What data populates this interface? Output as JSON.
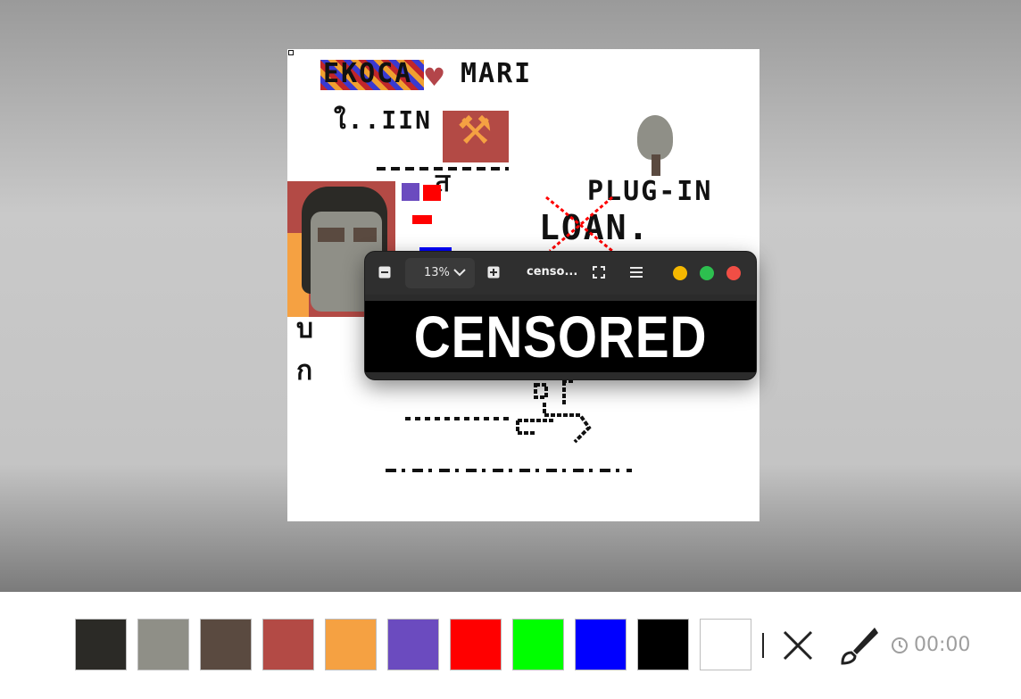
{
  "drawing": {
    "title_left": "EKOCA",
    "title_right": "MARI",
    "line2": "ใ..IIN",
    "plugin_text": "PLUG-IN",
    "loan_text": "LOAN."
  },
  "viewer": {
    "zoom_value": "13%",
    "filename": "censo...",
    "censored_text": "CENSORED"
  },
  "toolbar": {
    "palette": [
      {
        "name": "swatch-charcoal",
        "color": "#2b2a26"
      },
      {
        "name": "swatch-gray",
        "color": "#8f8f87"
      },
      {
        "name": "swatch-brown",
        "color": "#5a4a40"
      },
      {
        "name": "swatch-brick-red",
        "color": "#b34a45"
      },
      {
        "name": "swatch-orange",
        "color": "#f5a142"
      },
      {
        "name": "swatch-purple",
        "color": "#6b4bbf"
      },
      {
        "name": "swatch-red",
        "color": "#ff0000"
      },
      {
        "name": "swatch-green",
        "color": "#00ff00"
      },
      {
        "name": "swatch-blue",
        "color": "#0000ff"
      },
      {
        "name": "swatch-black",
        "color": "#000000"
      },
      {
        "name": "swatch-white",
        "color": "#ffffff"
      }
    ],
    "timer": "00:00"
  }
}
